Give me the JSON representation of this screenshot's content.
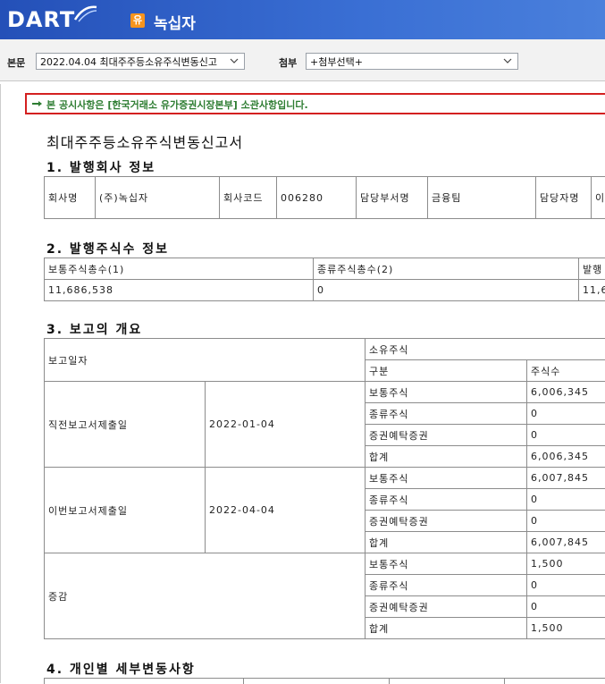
{
  "header": {
    "logo_text": "DART",
    "corp_badge": "유",
    "corp_name": "녹십자"
  },
  "toolbar": {
    "body_label": "본문",
    "body_select_value": "2022.04.04  최대주주등소유주식변동신고",
    "attach_label": "첨부",
    "attach_select_value": "+첨부선택+"
  },
  "notice": {
    "text": "본 공시사항은 [한국거래소 유가증권시장본부] 소관사항입니다."
  },
  "document": {
    "title": "최대주주등소유주식변동신고서",
    "section1": {
      "heading": "1. 발행회사 정보",
      "cells": [
        "회사명",
        "(주)녹십자",
        "회사코드",
        "006280",
        "담당부서명",
        "금융팀",
        "담당자명",
        "이"
      ]
    },
    "section2": {
      "heading": "2. 발행주식수 정보",
      "headers": [
        "보통주식총수(1)",
        "종류주식총수(2)",
        "발행"
      ],
      "values": [
        "11,686,538",
        "0",
        "11,6"
      ]
    },
    "section3": {
      "heading": "3. 보고의 개요",
      "report_date_label": "보고일자",
      "holding_label": "소유주식",
      "col_type": "구분",
      "col_shares": "주식수",
      "groups": [
        {
          "label": "직전보고서제출일",
          "date": "2022-01-04",
          "rows": [
            {
              "type": "보통주식",
              "shares": "6,006,345"
            },
            {
              "type": "종류주식",
              "shares": "0"
            },
            {
              "type": "증권예탁증권",
              "shares": "0"
            },
            {
              "type": "합계",
              "shares": "6,006,345"
            }
          ]
        },
        {
          "label": "이번보고서제출일",
          "date": "2022-04-04",
          "rows": [
            {
              "type": "보통주식",
              "shares": "6,007,845"
            },
            {
              "type": "종류주식",
              "shares": "0"
            },
            {
              "type": "증권예탁증권",
              "shares": "0"
            },
            {
              "type": "합계",
              "shares": "6,007,845"
            }
          ]
        },
        {
          "label": "증감",
          "date": "",
          "rows": [
            {
              "type": "보통주식",
              "shares": "1,500"
            },
            {
              "type": "종류주식",
              "shares": "0"
            },
            {
              "type": "증권예탁증권",
              "shares": "0"
            },
            {
              "type": "합계",
              "shares": "1,500"
            }
          ]
        }
      ]
    },
    "section4": {
      "heading": "4. 개인별 세부변동사항"
    }
  },
  "colors": {
    "header_blue": "#2b5aba",
    "notice_border": "#d42020",
    "notice_text": "#2e7d32",
    "badge_orange": "#f7941d"
  },
  "icons": [
    "dart-logo-swoosh-icon",
    "pointing-hand-icon",
    "chevron-down-icon"
  ]
}
